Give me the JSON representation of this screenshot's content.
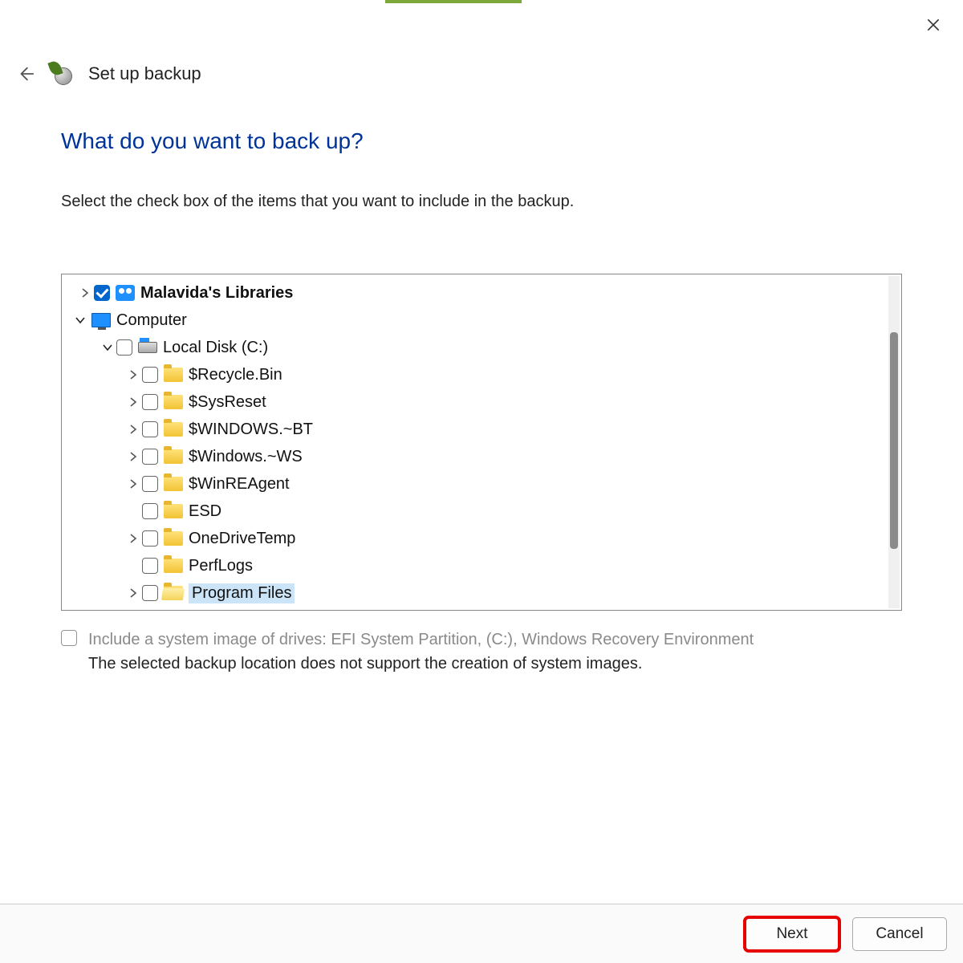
{
  "window": {
    "title": "Set up backup"
  },
  "main": {
    "heading": "What do you want to back up?",
    "instruction": "Select the check box of the items that you want to include in the backup."
  },
  "tree": {
    "libraries_label": "Malavida's Libraries",
    "computer_label": "Computer",
    "local_disk_label": "Local Disk (C:)",
    "folders": {
      "recycle": "$Recycle.Bin",
      "sysreset": "$SysReset",
      "windowsbt": "$WINDOWS.~BT",
      "windowsws": "$Windows.~WS",
      "winreagent": "$WinREAgent",
      "esd": "ESD",
      "onedrivetemp": "OneDriveTemp",
      "perflogs": "PerfLogs",
      "programfiles": "Program Files"
    }
  },
  "system_image": {
    "label": "Include a system image of drives: EFI System Partition, (C:), Windows Recovery Environment",
    "note": "The selected backup location does not support the creation of system images."
  },
  "footer": {
    "next": "Next",
    "cancel": "Cancel"
  }
}
